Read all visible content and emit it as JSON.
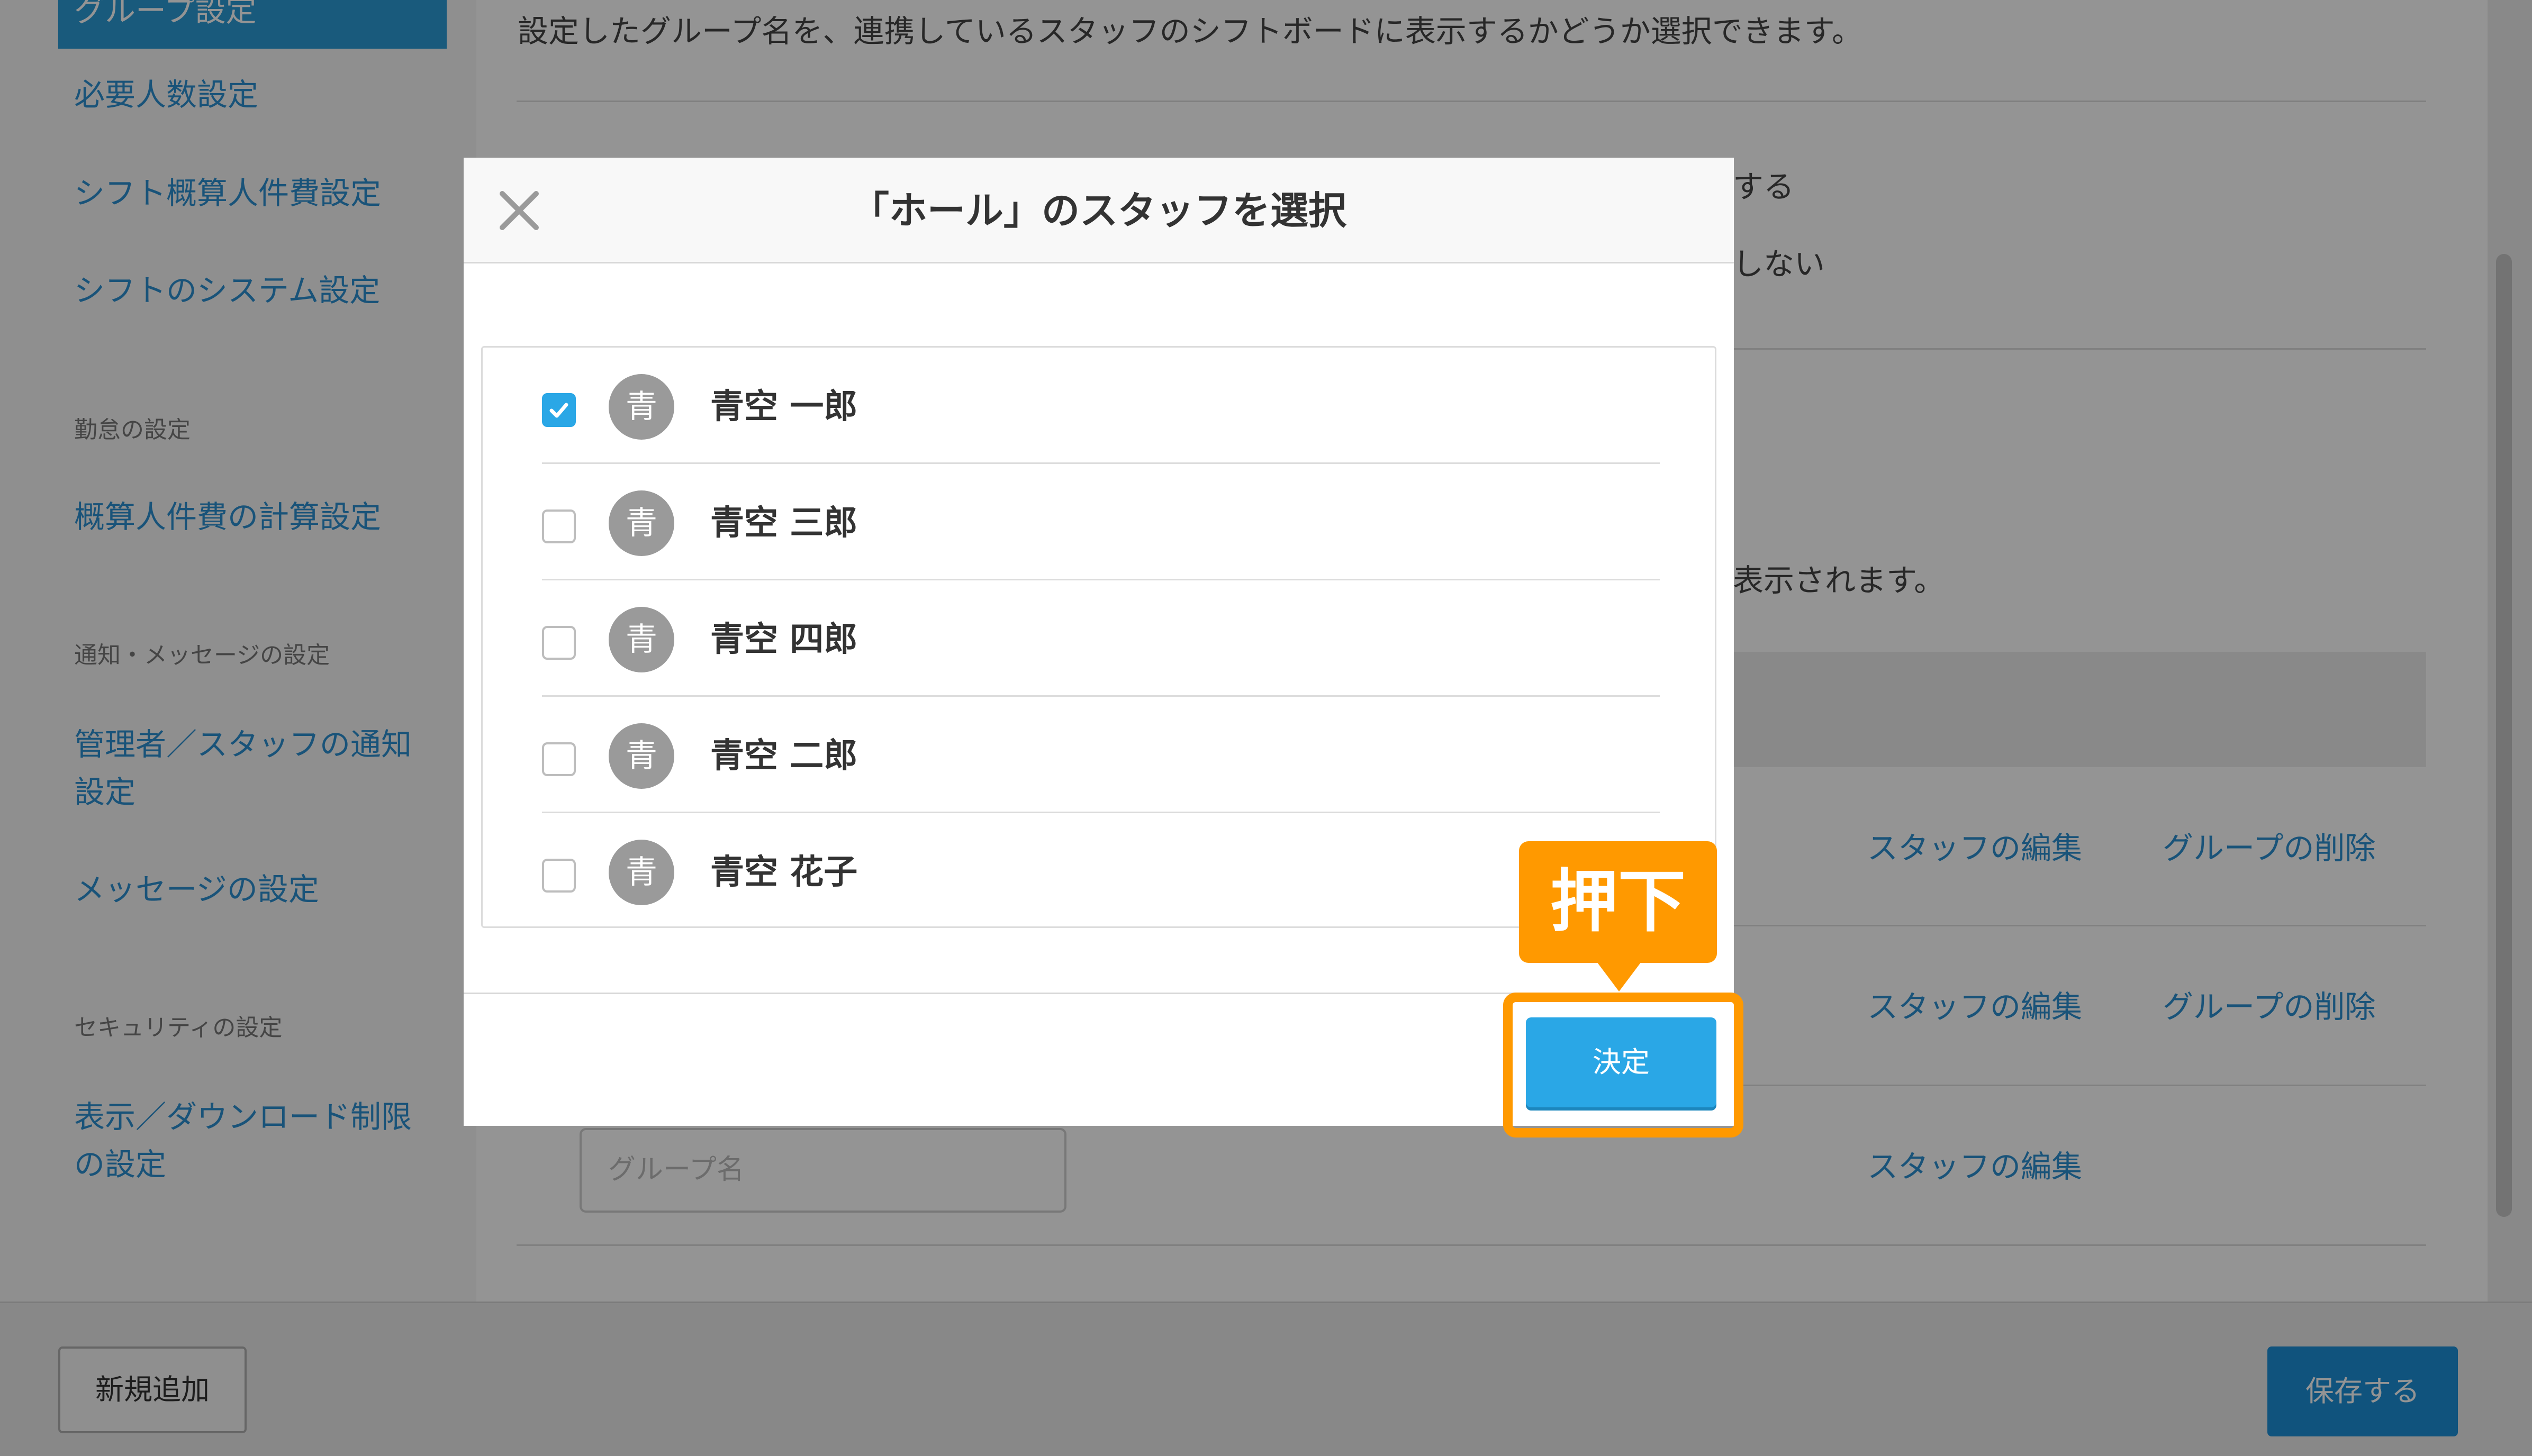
{
  "sidebar": {
    "active_item": "グループ設定",
    "items": [
      {
        "label": "必要人数設定"
      },
      {
        "label": "シフト概算人件費設定"
      },
      {
        "label": "シフトのシステム設定"
      },
      {
        "label": "概算人件費の計算設定"
      },
      {
        "label": "管理者／スタッフの通知設定"
      },
      {
        "label": "メッセージの設定"
      },
      {
        "label": "表示／ダウンロード制限の設定"
      }
    ],
    "headers": [
      "勤怠の設定",
      "通知・メッセージの設定",
      "セキュリティの設定"
    ]
  },
  "main": {
    "description": "設定したグループ名を、連携しているスタッフのシフトボードに表示するかどうか選択できます。",
    "option_show_partial": "する",
    "option_hide_partial": "しない",
    "note_partial": "表示されます。",
    "row_links": {
      "edit_staff": "スタッフの編集",
      "delete_group": "グループの削除"
    },
    "group_name_placeholder": "グループ名"
  },
  "footer": {
    "add_new": "新規追加",
    "save": "保存する"
  },
  "modal": {
    "title": "「ホール」のスタッフを選択",
    "avatar_char": "青",
    "staff": [
      {
        "name": "青空 一郎",
        "checked": true
      },
      {
        "name": "青空 三郎",
        "checked": false
      },
      {
        "name": "青空 四郎",
        "checked": false
      },
      {
        "name": "青空 二郎",
        "checked": false
      },
      {
        "name": "青空 花子",
        "checked": false
      }
    ],
    "confirm_label": "決定"
  },
  "annotation": {
    "callout_text": "押下"
  },
  "colors": {
    "primary": "#2aa7e6",
    "link": "#2b8fd0",
    "callout": "#ff9900"
  }
}
